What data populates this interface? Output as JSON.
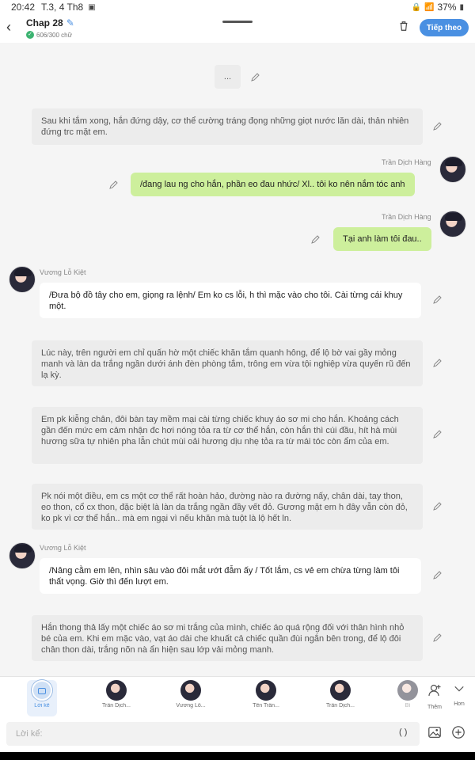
{
  "status": {
    "time": "20:42",
    "date": "T.3, 4 Th8",
    "battery": "37%"
  },
  "header": {
    "title": "Chap 28",
    "count": "606/300 chữ",
    "follow_label": "Tiếp theo"
  },
  "placeholder_row": "...",
  "messages": {
    "n1": "Sau khi tắm xong, hắn đứng dậy, cơ thể cường tráng đọng những giọt nước lăn dài, thản nhiên đứng trc mặt em.",
    "s1": "Trần Dịch Hàng",
    "b1": "/đang lau ng cho hắn, phần eo đau nhức/ Xl.. tôi ko nên nắm tóc anh",
    "s2": "Trần Dịch Hàng",
    "b2": "Tại anh làm tôi đau..",
    "s3": "Vương Lỗ Kiệt",
    "b3": "/Đưa bộ đồ tây cho em, giọng ra lệnh/ Em ko cs lỗi, h thì mặc vào cho tôi. Cài từng cái khuy một.",
    "n2": "Lúc này, trên người em chỉ quấn hờ một chiếc khăn tắm quanh hông, để lộ bờ vai gầy mỏng manh và làn da trắng ngần dưới ánh đèn phòng tắm, trông em vừa tội nghiệp vừa quyến rũ đến lạ kỳ.",
    "n3": "Em pk kiễng chân, đôi bàn tay mềm mại cài từng chiếc khuy áo sơ mi cho hắn. Khoảng cách gần đến mức em cảm nhận đc hơi nóng tỏa ra từ cơ thể hắn, còn hắn thì cúi đầu, hít hà mùi hương sữa tự nhiên pha lẫn chút mùi oải hương dịu nhẹ tỏa ra từ mái tóc còn ẩm của em.",
    "n4": "Pk nói một điều, em cs một cơ thể rất hoàn hảo, đường nào ra đường nấy, chân dài, tay thon, eo thon, cổ cx thon, đặc biệt là làn da trắng ngần đầy vết đỏ. Gương mặt em h đây vẫn còn đỏ, ko pk vì cơ thể hắn.. mà em ngại vì nếu khăn mà tuột là lộ hết ln.",
    "s4": "Vương Lỗ Kiệt",
    "b4": "/Nâng cằm em lên, nhìn sâu vào đôi mắt ướt đẫm ấy / Tốt lắm, cs vẻ em chừa từng làm tôi thất vọng. Giờ thì đến lượt em.",
    "n5": "Hắn thong thả lấy một chiếc áo sơ mi trắng của mình, chiếc áo quá rộng đối với thân hình nhỏ bé của em. Khi em mặc vào, vạt áo dài che khuất cả chiếc quần đùi ngắn bên trong, để lộ đôi chân thon dài, trắng nõn nà ẩn hiện sau lớp vải mỏng manh."
  },
  "characters": [
    "Lời kể",
    "Trần Dịch...",
    "Vương Lỗ...",
    "Tên Trần...",
    "Trần Dịch...",
    "Bì"
  ],
  "char_actions": {
    "add": "Thêm",
    "more": "Hơn"
  },
  "input": {
    "placeholder": "Lời kể:",
    "paren": "( )"
  }
}
